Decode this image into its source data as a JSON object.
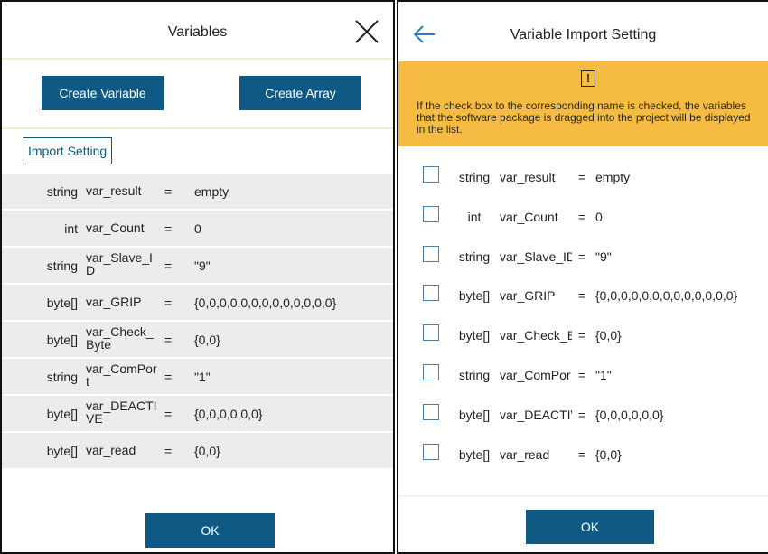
{
  "left": {
    "title": "Variables",
    "create_variable": "Create Variable",
    "create_array": "Create Array",
    "import_setting": "Import Setting",
    "ok": "OK",
    "rows": [
      {
        "type": "string",
        "name": "var_result",
        "eq": "=",
        "value": "empty"
      },
      {
        "type": "int",
        "name": "var_Count",
        "eq": "=",
        "value": "0"
      },
      {
        "type": "string",
        "name": "var_Slave_ID",
        "eq": "=",
        "value": "\"9\""
      },
      {
        "type": "byte[]",
        "name": "var_GRIP",
        "eq": "=",
        "value": "{0,0,0,0,0,0,0,0,0,0,0,0,0}"
      },
      {
        "type": "byte[]",
        "name": "var_Check_Byte",
        "eq": "=",
        "value": "{0,0}"
      },
      {
        "type": "string",
        "name": "var_ComPort",
        "eq": "=",
        "value": "\"1\""
      },
      {
        "type": "byte[]",
        "name": "var_DEACTIVE",
        "eq": "=",
        "value": "{0,0,0,0,0,0}"
      },
      {
        "type": "byte[]",
        "name": "var_read",
        "eq": "=",
        "value": "{0,0}"
      }
    ],
    "name_display": [
      "var_result",
      "var_Count",
      "var_Slave_I\nD",
      "var_GRIP",
      "var_Check_\nByte",
      "var_ComPor\nt",
      "var_DEACTI\nVE",
      "var_read"
    ]
  },
  "right": {
    "title": "Variable Import Setting",
    "warning_icon": "!",
    "warning_text": "If the check box to the corresponding name is checked, the variables that the software package is dragged into the project will be displayed in the list.",
    "ok": "OK",
    "rows": [
      {
        "type": "string",
        "name": "var_result",
        "eq": "=",
        "value": "empty",
        "checked": false
      },
      {
        "type": "int",
        "name": "var_Count",
        "eq": "=",
        "value": "0",
        "checked": false
      },
      {
        "type": "string",
        "name": "var_Slave_ID",
        "eq": "=",
        "value": "\"9\"",
        "checked": false
      },
      {
        "type": "byte[]",
        "name": "var_GRIP",
        "eq": "=",
        "value": "{0,0,0,0,0,0,0,0,0,0,0,0,0}",
        "checked": false
      },
      {
        "type": "byte[]",
        "name": "var_Check_B",
        "eq": "=",
        "value": "{0,0}",
        "checked": false
      },
      {
        "type": "string",
        "name": "var_ComPor",
        "eq": "=",
        "value": "\"1\"",
        "checked": false
      },
      {
        "type": "byte[]",
        "name": "var_DEACTI\\",
        "eq": "=",
        "value": "{0,0,0,0,0,0}",
        "checked": false
      },
      {
        "type": "byte[]",
        "name": "var_read",
        "eq": "=",
        "value": "{0,0}",
        "checked": false
      }
    ]
  },
  "colors": {
    "accent": "#0e5a85",
    "warning": "#f6bb42",
    "row_bg": "#ececec",
    "divider": "#f2eed2"
  }
}
